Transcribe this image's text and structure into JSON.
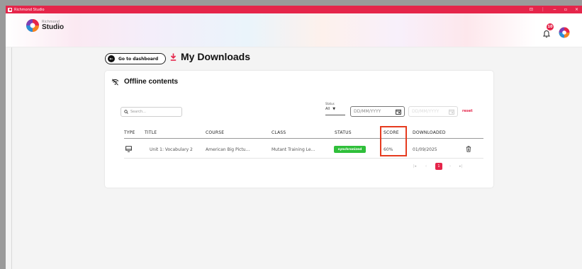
{
  "window": {
    "title": "Richmond Studio",
    "controls": [
      "⊡",
      "⋮",
      "−",
      "▫",
      "×"
    ]
  },
  "brand": {
    "small": "Richmond",
    "big": "Studio"
  },
  "header": {
    "notification_count": "10"
  },
  "page": {
    "back_label": "Go to dashboard",
    "title": "My Downloads"
  },
  "card": {
    "title": "Offline contents",
    "search": {
      "placeholder": "Search..."
    },
    "status_filter": {
      "label": "Status",
      "value": "All"
    },
    "date_from": {
      "placeholder": "DD/MM/YYYY"
    },
    "date_to": {
      "placeholder": "DD/MM/YYYY"
    },
    "reset_label": "reset"
  },
  "table": {
    "columns": [
      "TYPE",
      "TITLE",
      "COURSE",
      "CLASS",
      "STATUS",
      "SCORE",
      "DOWNLOADED"
    ],
    "rows": [
      {
        "type_icon": "monitor-icon",
        "title": "Unit 1: Vocabulary 2",
        "course": "American Big Pictu...",
        "class": "Mutant Training Le...",
        "status": "synchronized",
        "score": "60%",
        "downloaded": "01/09/2025"
      }
    ]
  },
  "pagination": {
    "first": "|◂",
    "prev": "‹",
    "current": "1",
    "next": "›",
    "last": "▸|"
  },
  "colors": {
    "brand": "#e5254a",
    "success": "#2fbf3a",
    "highlight": "#e63b1f"
  }
}
